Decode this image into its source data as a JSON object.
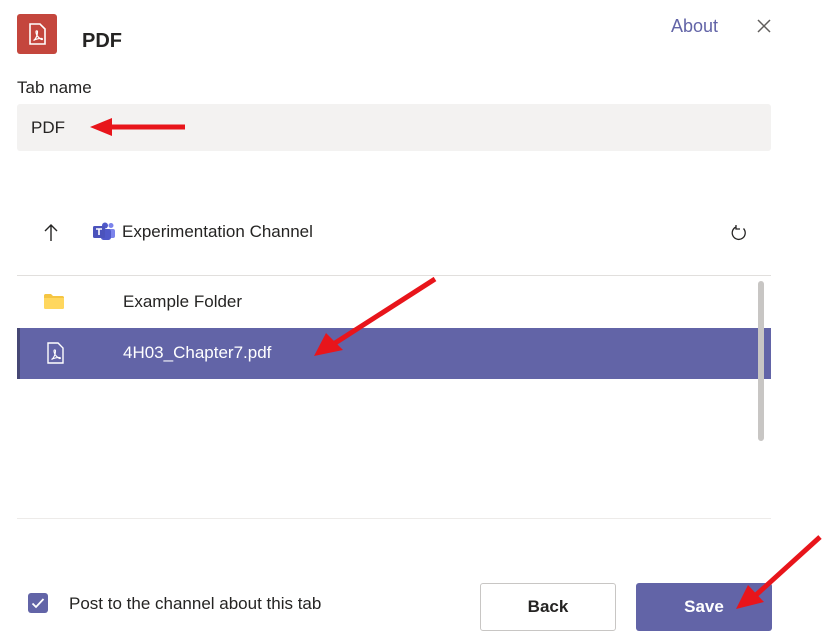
{
  "header": {
    "app_icon": "pdf-file-icon",
    "title": "PDF",
    "about_link": "About",
    "close_icon": "close-icon"
  },
  "tab_name": {
    "label": "Tab name",
    "value": "PDF"
  },
  "browser": {
    "up_icon": "arrow-up-icon",
    "logo_icon": "teams-logo-icon",
    "channel_name": "Experimentation Channel",
    "refresh_icon": "refresh-icon",
    "items": [
      {
        "name": "Example Folder",
        "icon": "folder-icon",
        "selected": false
      },
      {
        "name": "4H03_Chapter7.pdf",
        "icon": "pdf-file-icon",
        "selected": true
      }
    ]
  },
  "footer": {
    "post_checkbox_checked": true,
    "post_checkbox_label": "Post to the channel about this tab",
    "back_label": "Back",
    "save_label": "Save"
  },
  "colors": {
    "accent": "#6264a7",
    "pdf_brand": "#c4463d",
    "folder": "#f5c542",
    "annotation_arrow": "#e8151b"
  }
}
